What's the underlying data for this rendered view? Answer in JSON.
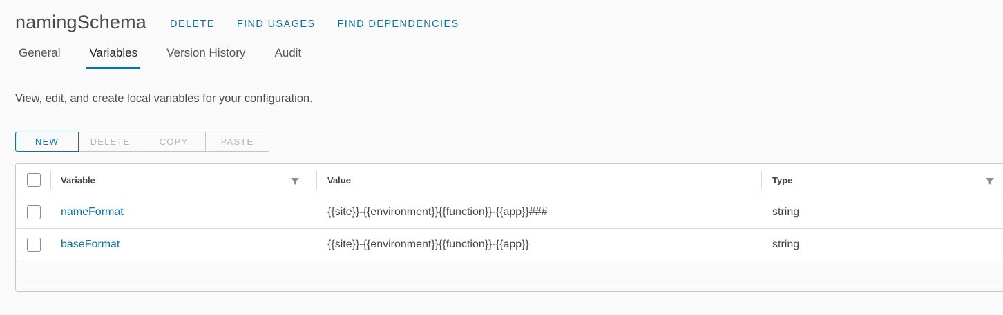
{
  "header": {
    "title": "namingSchema",
    "actions": [
      "DELETE",
      "FIND USAGES",
      "FIND DEPENDENCIES"
    ]
  },
  "tabs": [
    {
      "label": "General",
      "active": false
    },
    {
      "label": "Variables",
      "active": true
    },
    {
      "label": "Version History",
      "active": false
    },
    {
      "label": "Audit",
      "active": false
    }
  ],
  "description": "View, edit, and create local variables for your configuration.",
  "toolbar": {
    "new_label": "NEW",
    "delete_label": "DELETE",
    "copy_label": "COPY",
    "paste_label": "PASTE"
  },
  "grid": {
    "columns": {
      "variable": "Variable",
      "value": "Value",
      "type": "Type"
    },
    "rows": [
      {
        "variable": "nameFormat",
        "value": "{{site}}-{{environment}}{{function}}-{{app}}###",
        "type": "string"
      },
      {
        "variable": "baseFormat",
        "value": "{{site}}-{{environment}}{{function}}-{{app}}",
        "type": "string"
      }
    ]
  },
  "colors": {
    "accent": "#0a72b0",
    "background": "#fafafa"
  }
}
